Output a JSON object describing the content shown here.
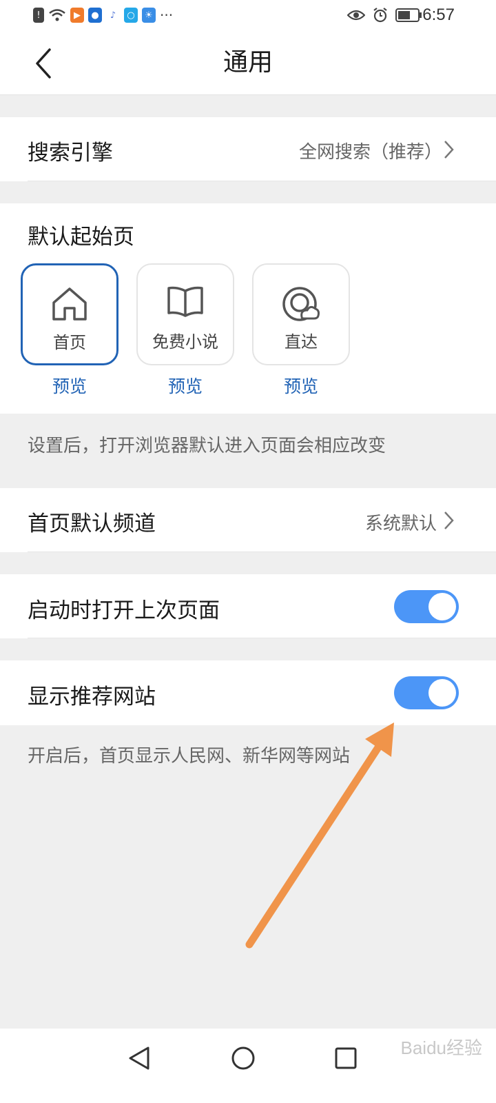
{
  "status_bar": {
    "time": "6:57",
    "more": "···",
    "icons": [
      "alert-icon",
      "wifi-icon",
      "video-app-icon",
      "bulb-app-icon",
      "music-app-icon",
      "search-app-icon",
      "weather-app-icon"
    ]
  },
  "header": {
    "title": "通用"
  },
  "search_engine": {
    "label": "搜索引擎",
    "value": "全网搜索（推荐）"
  },
  "start_page": {
    "label": "默认起始页",
    "options": [
      {
        "label": "首页",
        "preview": "预览",
        "selected": true
      },
      {
        "label": "免费小说",
        "preview": "预览",
        "selected": false
      },
      {
        "label": "直达",
        "preview": "预览",
        "selected": false
      }
    ],
    "hint": "设置后，打开浏览器默认进入页面会相应改变"
  },
  "home_channel": {
    "label": "首页默认频道",
    "value": "系统默认"
  },
  "open_last": {
    "label": "启动时打开上次页面",
    "enabled": true
  },
  "show_sites": {
    "label": "显示推荐网站",
    "enabled": true,
    "hint": "开启后，首页显示人民网、新华网等网站"
  },
  "watermark": "Baidu经验",
  "colors": {
    "accent": "#2163b5",
    "toggle_on": "#4c96f7",
    "annotation_arrow": "#f0944a"
  }
}
